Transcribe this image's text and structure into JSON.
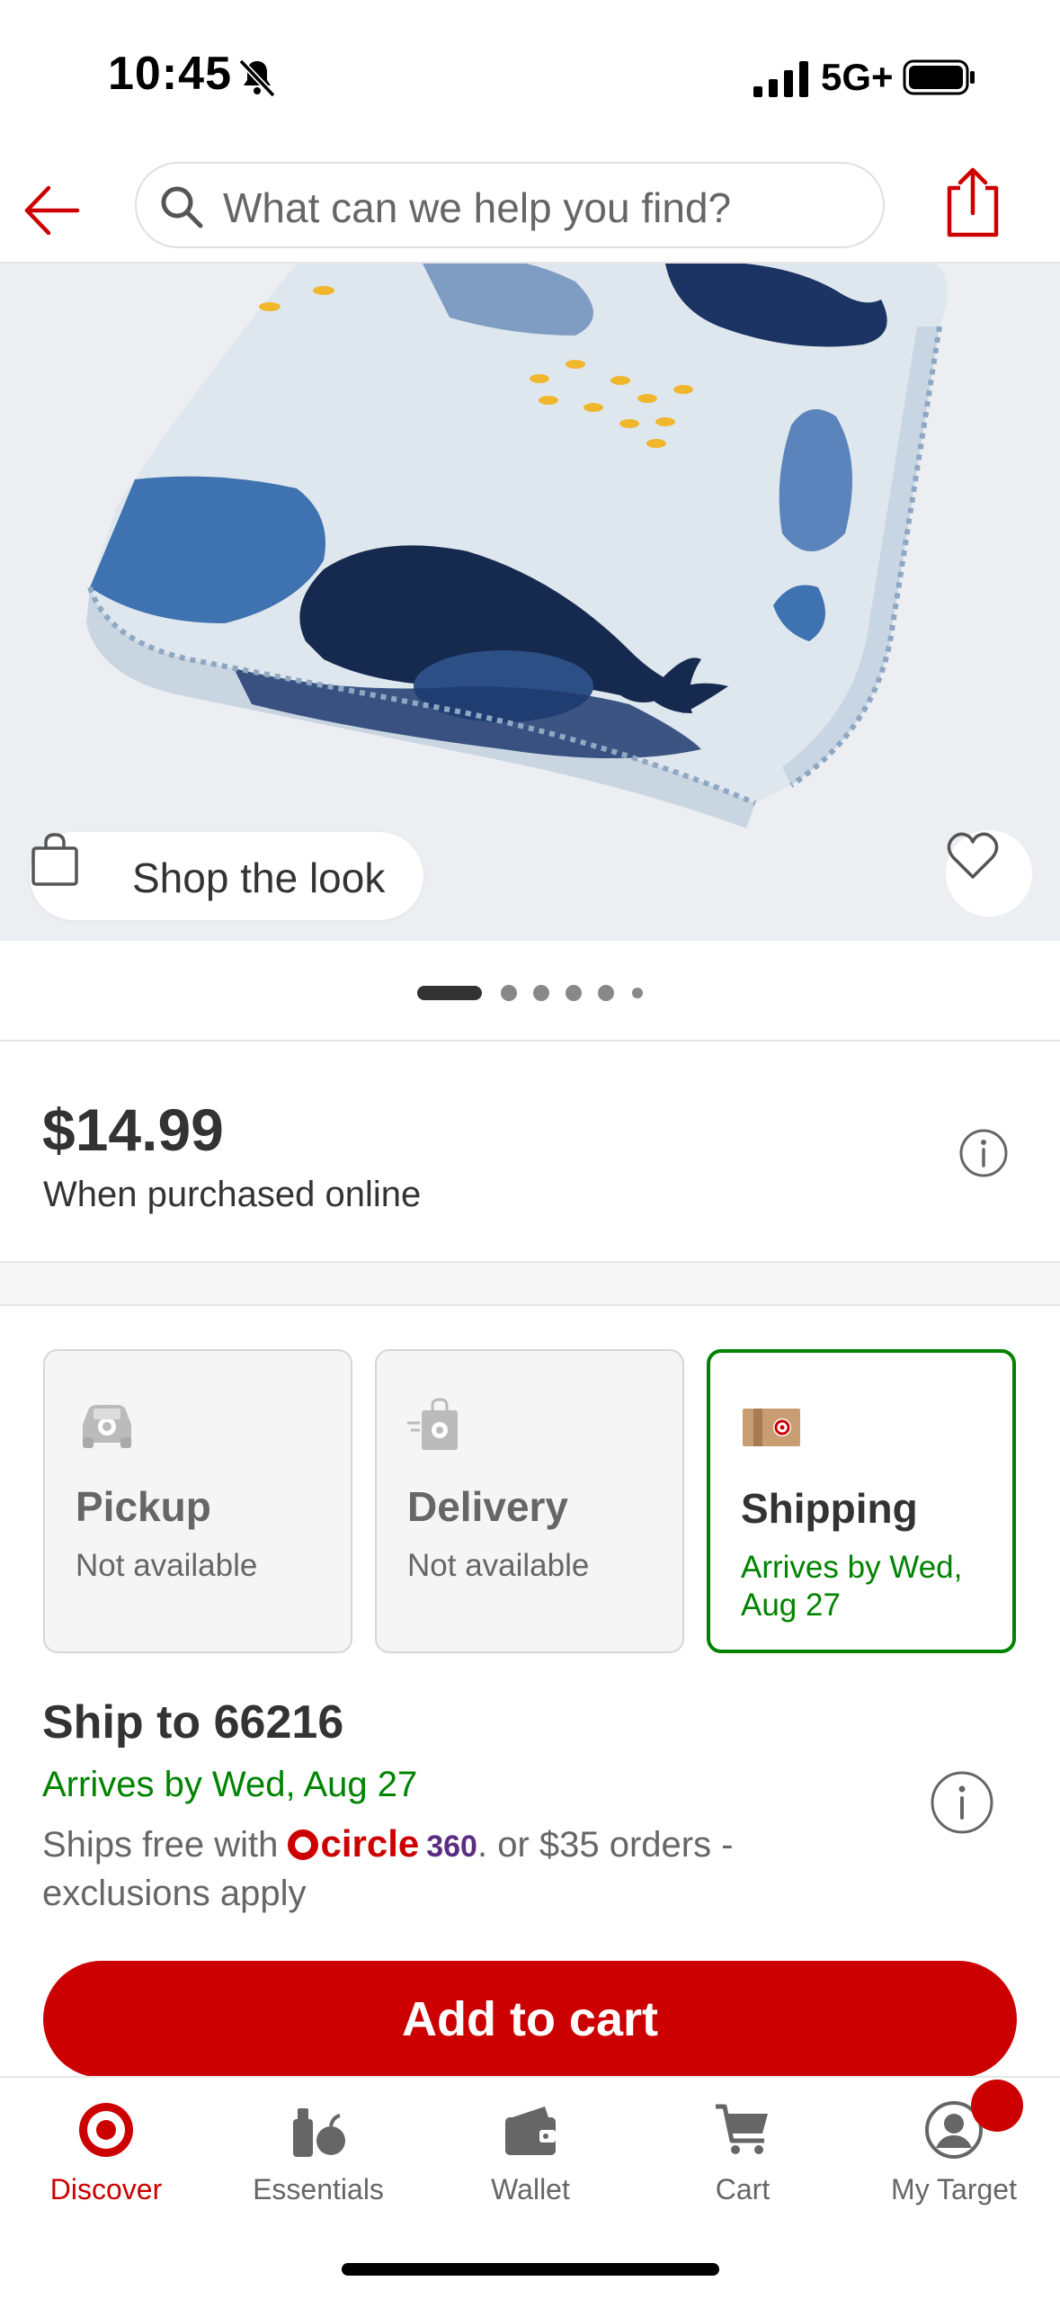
{
  "status_bar": {
    "time": "10:45",
    "network": "5G+"
  },
  "header": {
    "search_placeholder": "What can we help you find?"
  },
  "product_image": {
    "shop_the_look_label": "Shop the look"
  },
  "carousel": {
    "total_images": 6,
    "active_index": 0
  },
  "price_section": {
    "price": "$14.99",
    "note": "When purchased online"
  },
  "fulfillment": {
    "options": [
      {
        "title": "Pickup",
        "status": "Not available",
        "selected": false,
        "icon": "pickup-car-icon"
      },
      {
        "title": "Delivery",
        "status": "Not available",
        "selected": false,
        "icon": "delivery-bag-icon"
      },
      {
        "title": "Shipping",
        "status": "Arrives by Wed, Aug 27",
        "selected": true,
        "icon": "shipping-box-icon"
      }
    ]
  },
  "ship_to": {
    "title": "Ship to 66216",
    "arrives": "Arrives by Wed, Aug 27",
    "note_prefix": "Ships free with",
    "circle_word": "circle",
    "circle_number": "360",
    "note_suffix": ". or $35 orders - exclusions apply"
  },
  "add_to_cart_label": "Add to cart",
  "tab_bar": {
    "tabs": [
      {
        "label": "Discover",
        "icon": "target-bullseye-icon",
        "active": true
      },
      {
        "label": "Essentials",
        "icon": "essentials-icon",
        "active": false
      },
      {
        "label": "Wallet",
        "icon": "wallet-icon",
        "active": false
      },
      {
        "label": "Cart",
        "icon": "cart-icon",
        "active": false
      },
      {
        "label": "My Target",
        "icon": "account-icon",
        "active": false
      }
    ]
  },
  "colors": {
    "brand_red": "#cc0000",
    "success_green": "#008300",
    "text_dark": "#333333",
    "text_muted": "#666666"
  }
}
